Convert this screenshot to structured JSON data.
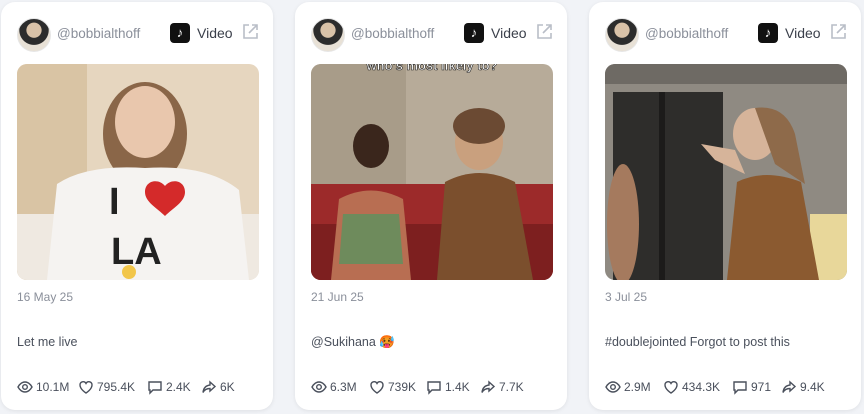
{
  "cards": [
    {
      "handle": "@bobbialthoff",
      "type_label": "Video",
      "date": "16 May 25",
      "caption": "Let me live",
      "thumbnail_text": "",
      "stats": {
        "views": "10.1M",
        "likes": "795.4K",
        "comments": "2.4K",
        "shares": "6K"
      }
    },
    {
      "handle": "@bobbialthoff",
      "type_label": "Video",
      "date": "21 Jun 25",
      "caption": "@Sukihana 🥵",
      "thumbnail_text": "who's most likely to?",
      "stats": {
        "views": "6.3M",
        "likes": "739K",
        "comments": "1.4K",
        "shares": "7.7K"
      }
    },
    {
      "handle": "@bobbialthoff",
      "type_label": "Video",
      "date": "3 Jul 25",
      "caption": "#doublejointed Forgot to post this",
      "thumbnail_text": "",
      "stats": {
        "views": "2.9M",
        "likes": "434.3K",
        "comments": "971",
        "shares": "9.4K"
      }
    }
  ],
  "icons": {
    "platform": "tiktok-icon",
    "open": "external-link-icon",
    "views": "eye-icon",
    "likes": "heart-icon",
    "comments": "comment-icon",
    "shares": "share-icon"
  },
  "colors": {
    "background": "#f1f3f7",
    "card": "#ffffff",
    "muted_text": "#8a8f9a",
    "body_text": "#4a505c"
  }
}
